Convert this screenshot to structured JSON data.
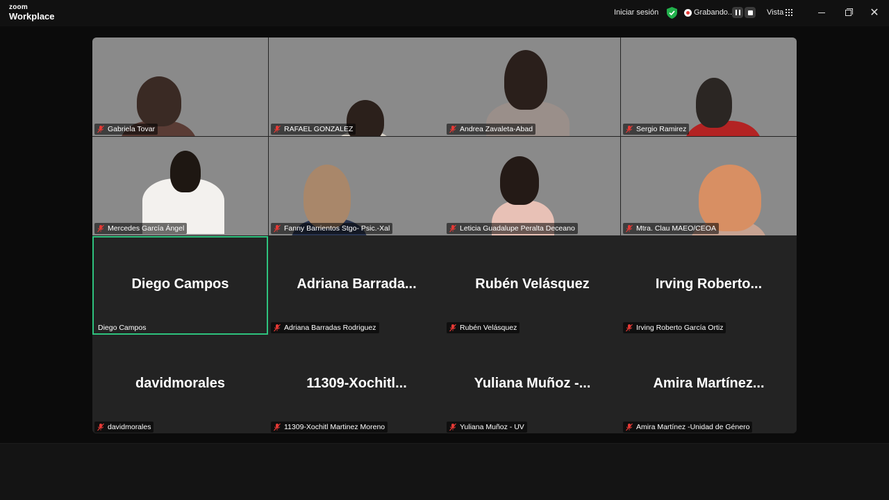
{
  "app": {
    "logo_top": "zoom",
    "logo_bottom": "Workplace"
  },
  "titlebar": {
    "signin": "Iniciar sesión",
    "recording": "Grabando...",
    "view": "Vista"
  },
  "participants": [
    {
      "tag": "Gabriela Tovar",
      "video": true,
      "muted": true
    },
    {
      "tag": "RAFAEL GONZALEZ",
      "video": true,
      "muted": true
    },
    {
      "tag": "Andrea Zavaleta-Abad",
      "video": true,
      "muted": true
    },
    {
      "tag": "Sergio Ramirez",
      "video": true,
      "muted": true
    },
    {
      "tag": "Mercedes García Ángel",
      "video": true,
      "muted": true
    },
    {
      "tag": "Fanny Barrientos Stgo- Psic.-Xal",
      "video": true,
      "muted": true
    },
    {
      "tag": "Leticia Guadalupe Peralta Deceano",
      "video": true,
      "muted": true
    },
    {
      "tag": "Mtra. Clau MAEO/CEOA",
      "video": true,
      "muted": true
    },
    {
      "tag": "Diego Campos",
      "big": "Diego Campos",
      "video": false,
      "muted": false
    },
    {
      "tag": "Adriana Barradas Rodriguez",
      "big": "Adriana  Barrada...",
      "video": false,
      "muted": true
    },
    {
      "tag": "Rubén Velásquez",
      "big": "Rubén Velásquez",
      "video": false,
      "muted": true
    },
    {
      "tag": "Irving Roberto García Ortiz",
      "big": "Irving  Roberto...",
      "video": false,
      "muted": true
    },
    {
      "tag": "davidmorales",
      "big": "davidmorales",
      "video": false,
      "muted": true
    },
    {
      "tag": "11309-Xochitl Martinez Moreno",
      "big": "11309-Xochitl...",
      "video": false,
      "muted": true
    },
    {
      "tag": "Yuliana Muñoz - UV",
      "big": "Yuliana  Muñoz  -...",
      "video": false,
      "muted": true
    },
    {
      "tag": "Amira Martínez -Unidad de Género",
      "big": "Amira  Martínez...",
      "video": false,
      "muted": true
    }
  ],
  "colors": {
    "active_speaker": "#2ec27e",
    "muted_icon": "#e53935",
    "shield": "#22b14c"
  }
}
